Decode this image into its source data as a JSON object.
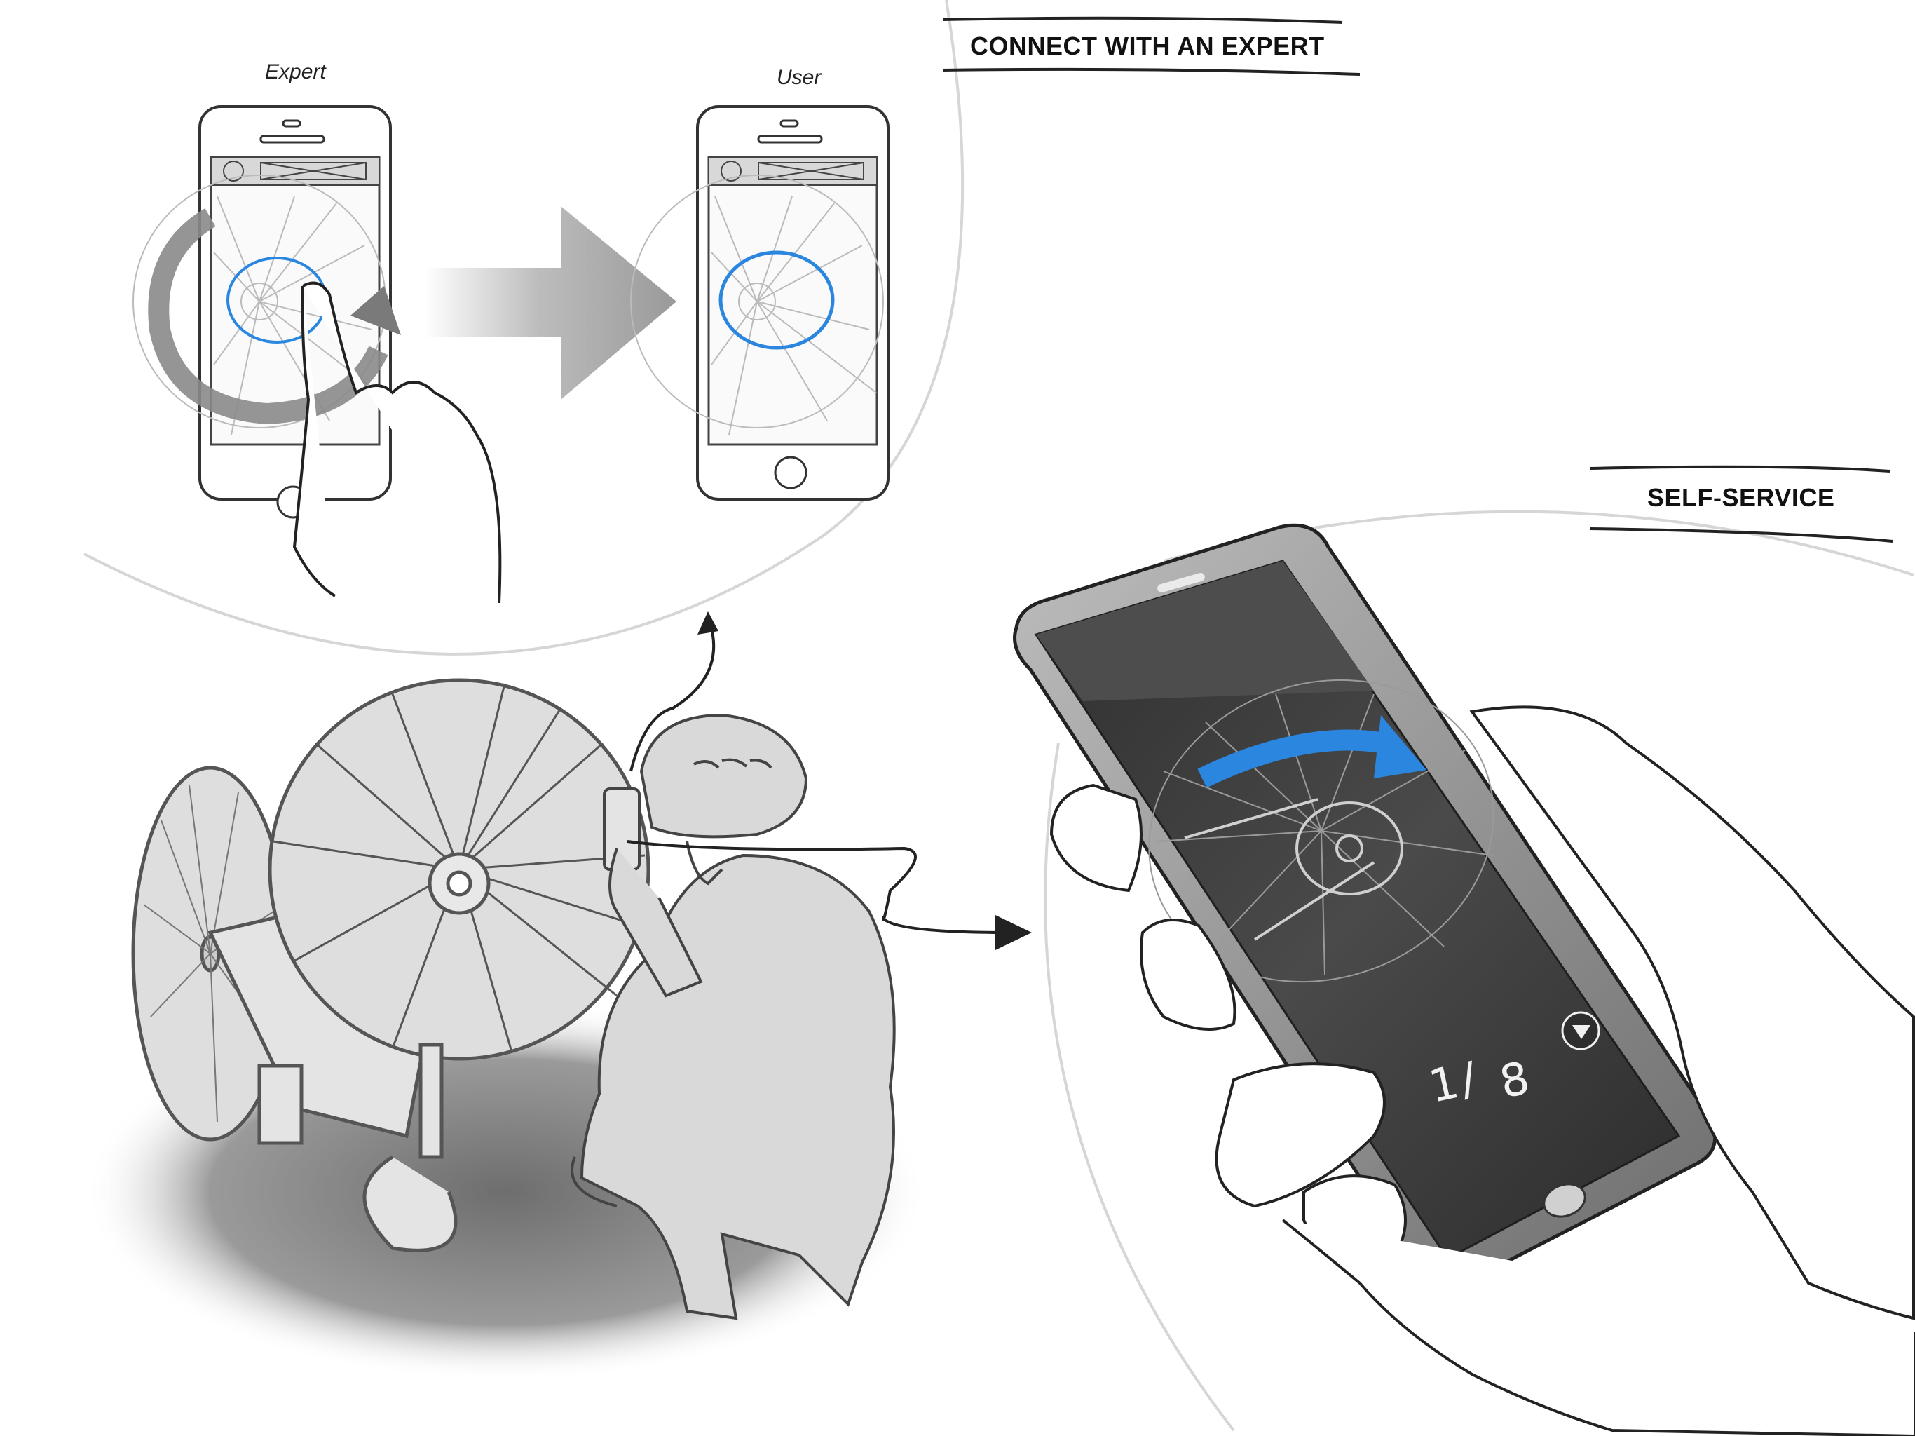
{
  "sections": {
    "expert_connect": {
      "title": "CONNECT WITH AN EXPERT"
    },
    "self_service": {
      "title": "SELF-SERVICE"
    }
  },
  "phones": {
    "expert": {
      "label": "Expert"
    },
    "user": {
      "label": "User"
    }
  },
  "handheld_phone": {
    "step_counter": {
      "current": "1",
      "separator": "/",
      "total": "8"
    },
    "icons": [
      "next-step-icon",
      "curved-arrow-icon"
    ]
  },
  "colors": {
    "accent_blue": "#2b86e0",
    "dark_screen": "#3a3a3a",
    "figure_fill": "#d9d9d9",
    "shadow": "#7a7a7a"
  }
}
